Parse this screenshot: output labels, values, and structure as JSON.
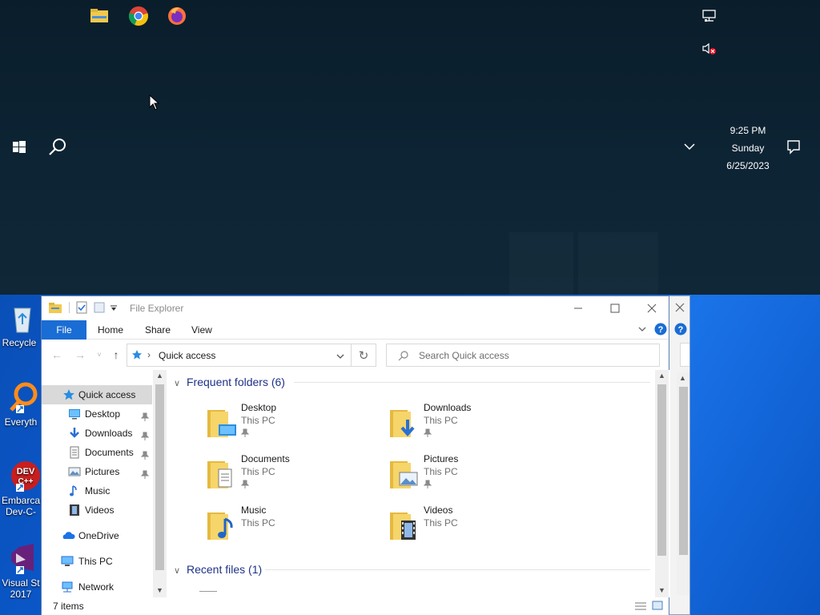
{
  "taskbar": {
    "pinned": [
      {
        "name": "file-explorer-pinned"
      },
      {
        "name": "chrome-pinned"
      },
      {
        "name": "firefox-pinned"
      }
    ],
    "clock": {
      "time": "9:25 PM",
      "day": "Sunday",
      "date": "6/25/2023"
    }
  },
  "desktop": {
    "icons": [
      {
        "label": "Recycle"
      },
      {
        "label": "Everyth"
      },
      {
        "label": "Embarca Dev-C-"
      },
      {
        "label": "Visual St 2017"
      }
    ]
  },
  "explorer": {
    "title": "File Explorer",
    "ribbon": {
      "file": "File",
      "home": "Home",
      "share": "Share",
      "view": "View"
    },
    "address": {
      "crumb": "Quick access"
    },
    "search": {
      "placeholder": "Search Quick access"
    },
    "nav": {
      "quick_access": "Quick access",
      "desktop": "Desktop",
      "downloads": "Downloads",
      "documents": "Documents",
      "pictures": "Pictures",
      "music": "Music",
      "videos": "Videos",
      "onedrive": "OneDrive",
      "this_pc": "This PC",
      "network": "Network"
    },
    "frequent_header": "Frequent folders (6)",
    "recent_header": "Recent files (1)",
    "folders": [
      {
        "name": "Desktop",
        "location": "This PC"
      },
      {
        "name": "Downloads",
        "location": "This PC"
      },
      {
        "name": "Documents",
        "location": "This PC"
      },
      {
        "name": "Pictures",
        "location": "This PC"
      },
      {
        "name": "Music",
        "location": "This PC"
      },
      {
        "name": "Videos",
        "location": "This PC"
      }
    ],
    "status": {
      "items": "7 items"
    }
  },
  "colors": {
    "accent": "#1a6dd4",
    "desktop_blue": "#0b5ed6",
    "start_dark": "#0c2030",
    "folder_yellow": "#f2c94c"
  }
}
